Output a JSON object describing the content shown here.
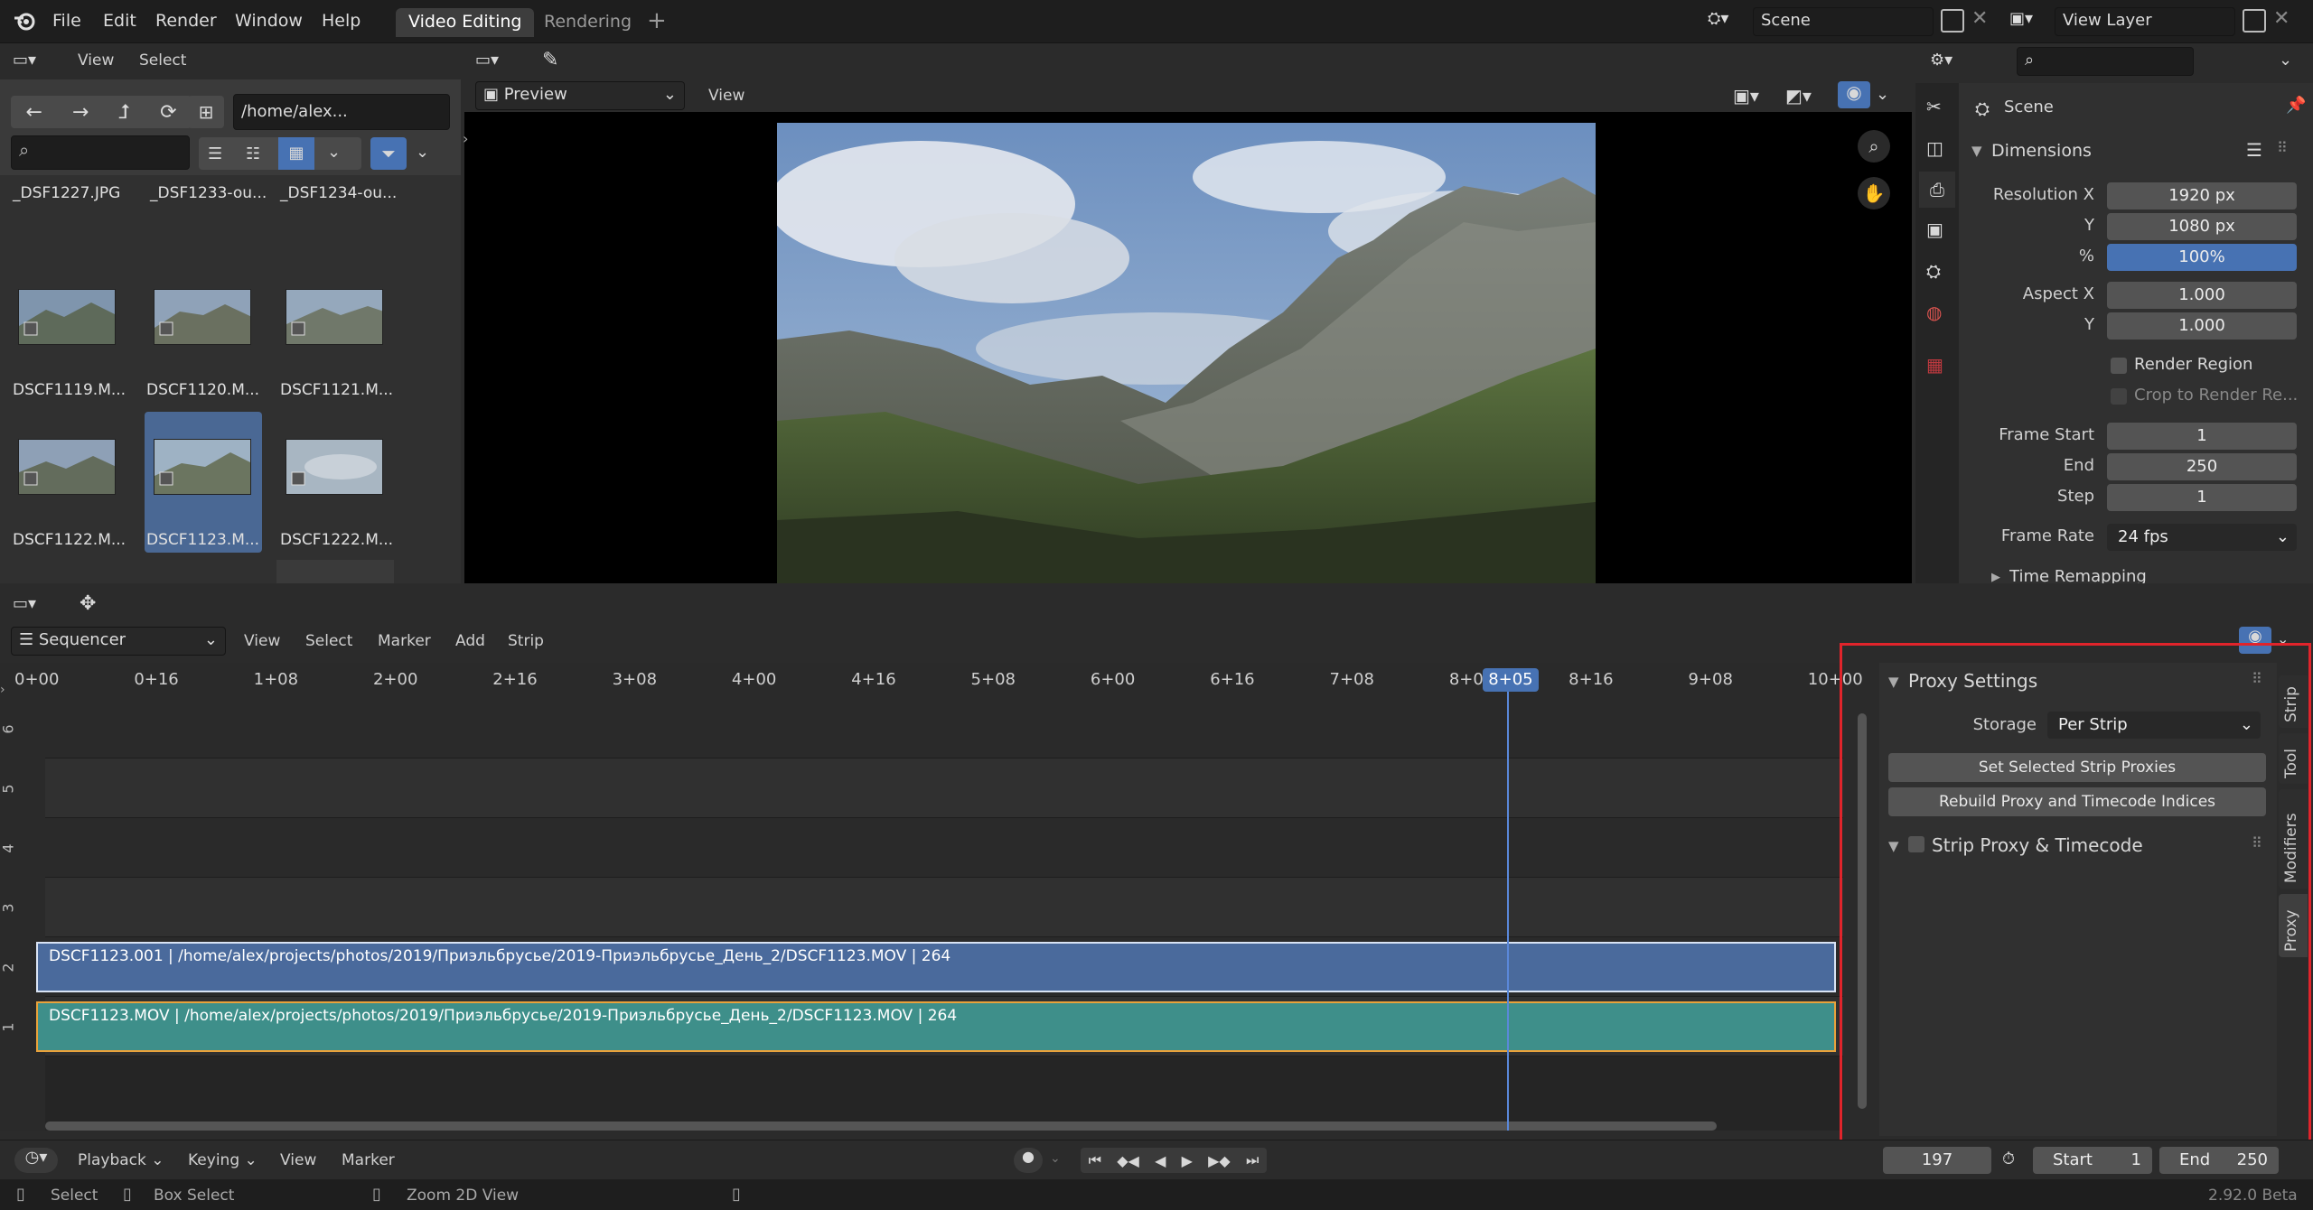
{
  "topbar": {
    "menus": [
      "File",
      "Edit",
      "Render",
      "Window",
      "Help"
    ],
    "tabs": [
      {
        "label": "Video Editing",
        "active": true
      },
      {
        "label": "Rendering",
        "active": false
      }
    ],
    "add_tab": "+",
    "scene_name": "Scene",
    "view_layer": "View Layer"
  },
  "file_browser": {
    "menus": [
      "View",
      "Select"
    ],
    "path": "/home/alex...",
    "search_placeholder": "",
    "items": [
      {
        "label": "_DSF1227.JPG",
        "thumb": "none"
      },
      {
        "label": "_DSF1233-ou...",
        "thumb": "none"
      },
      {
        "label": "_DSF1234-ou...",
        "thumb": "none"
      },
      {
        "label": "DSCF1119.M...",
        "thumb": "mountain"
      },
      {
        "label": "DSCF1120.M...",
        "thumb": "mountain"
      },
      {
        "label": "DSCF1121.M...",
        "thumb": "mountain"
      },
      {
        "label": "DSCF1122.M...",
        "thumb": "mountain"
      },
      {
        "label": "DSCF1123.M...",
        "thumb": "mountain",
        "selected": true
      },
      {
        "label": "DSCF1222.M...",
        "thumb": "clouds"
      },
      {
        "label": "",
        "thumb": "mountain"
      },
      {
        "label": "",
        "thumb": "mountain"
      },
      {
        "label": "",
        "thumb": "mountain"
      }
    ]
  },
  "preview": {
    "mode": "Preview",
    "view_menu": "View"
  },
  "properties": {
    "context": "Scene",
    "section": "Dimensions",
    "resolution_x_label": "Resolution X",
    "resolution_x": "1920 px",
    "resolution_y_label": "Y",
    "resolution_y": "1080 px",
    "percent_label": "%",
    "percent": "100%",
    "aspect_x_label": "Aspect X",
    "aspect_x": "1.000",
    "aspect_y_label": "Y",
    "aspect_y": "1.000",
    "render_region": "Render Region",
    "crop_to_render": "Crop to Render Re...",
    "frame_start_label": "Frame Start",
    "frame_start": "1",
    "end_label": "End",
    "end": "250",
    "step_label": "Step",
    "step": "1",
    "frame_rate_label": "Frame Rate",
    "frame_rate": "24 fps",
    "time_remapping": "Time Remapping"
  },
  "sequencer": {
    "editor": "Sequencer",
    "menus": [
      "View",
      "Select",
      "Marker",
      "Add",
      "Strip"
    ],
    "ruler": [
      {
        "label": "0+00",
        "frame": 0
      },
      {
        "label": "0+16",
        "frame": 16
      },
      {
        "label": "1+08",
        "frame": 32
      },
      {
        "label": "2+00",
        "frame": 48
      },
      {
        "label": "2+16",
        "frame": 64
      },
      {
        "label": "3+08",
        "frame": 80
      },
      {
        "label": "4+00",
        "frame": 96
      },
      {
        "label": "4+16",
        "frame": 112
      },
      {
        "label": "5+08",
        "frame": 128
      },
      {
        "label": "6+00",
        "frame": 144
      },
      {
        "label": "6+16",
        "frame": 160
      },
      {
        "label": "7+08",
        "frame": 176
      },
      {
        "label": "8+0",
        "frame": 192
      },
      {
        "label": "8+16",
        "frame": 208
      },
      {
        "label": "9+08",
        "frame": 224
      },
      {
        "label": "10+00",
        "frame": 240
      }
    ],
    "current_frame_label": "8+05",
    "current_frame": 197,
    "channels": [
      "6",
      "5",
      "4",
      "3",
      "2",
      "1"
    ],
    "strips": [
      {
        "channel": 2,
        "label": "DSCF1123.001 | /home/alex/projects/photos/2019/Приэльбрусье/2019-Приэльбрусье_День_2/DSCF1123.MOV | 264",
        "color": "#4a6a9c",
        "start": 0,
        "end": 264
      },
      {
        "channel": 1,
        "label": "DSCF1123.MOV | /home/alex/projects/photos/2019/Приэльбрусье/2019-Приэльбрусье_День_2/DSCF1123.MOV | 264",
        "color": "#3e8f8a",
        "start": 0,
        "end": 264
      }
    ]
  },
  "sidebar": {
    "proxy_settings": "Proxy Settings",
    "storage_label": "Storage",
    "storage_value": "Per Strip",
    "set_selected": "Set Selected Strip Proxies",
    "rebuild": "Rebuild Proxy and Timecode Indices",
    "strip_proxy": "Strip Proxy & Timecode",
    "tabs": [
      "Strip",
      "Tool",
      "Modifiers",
      "Proxy"
    ],
    "active_tab": "Proxy",
    "highlight_color": "#e0242b"
  },
  "timeline": {
    "menus": [
      "Playback",
      "Keying",
      "View",
      "Marker"
    ],
    "current_frame": "197",
    "start_label": "Start",
    "start": "1",
    "end_label": "End",
    "end": "250"
  },
  "statusbar": {
    "select": "Select",
    "box_select": "Box Select",
    "zoom": "Zoom 2D View",
    "version": "2.92.0 Beta"
  }
}
